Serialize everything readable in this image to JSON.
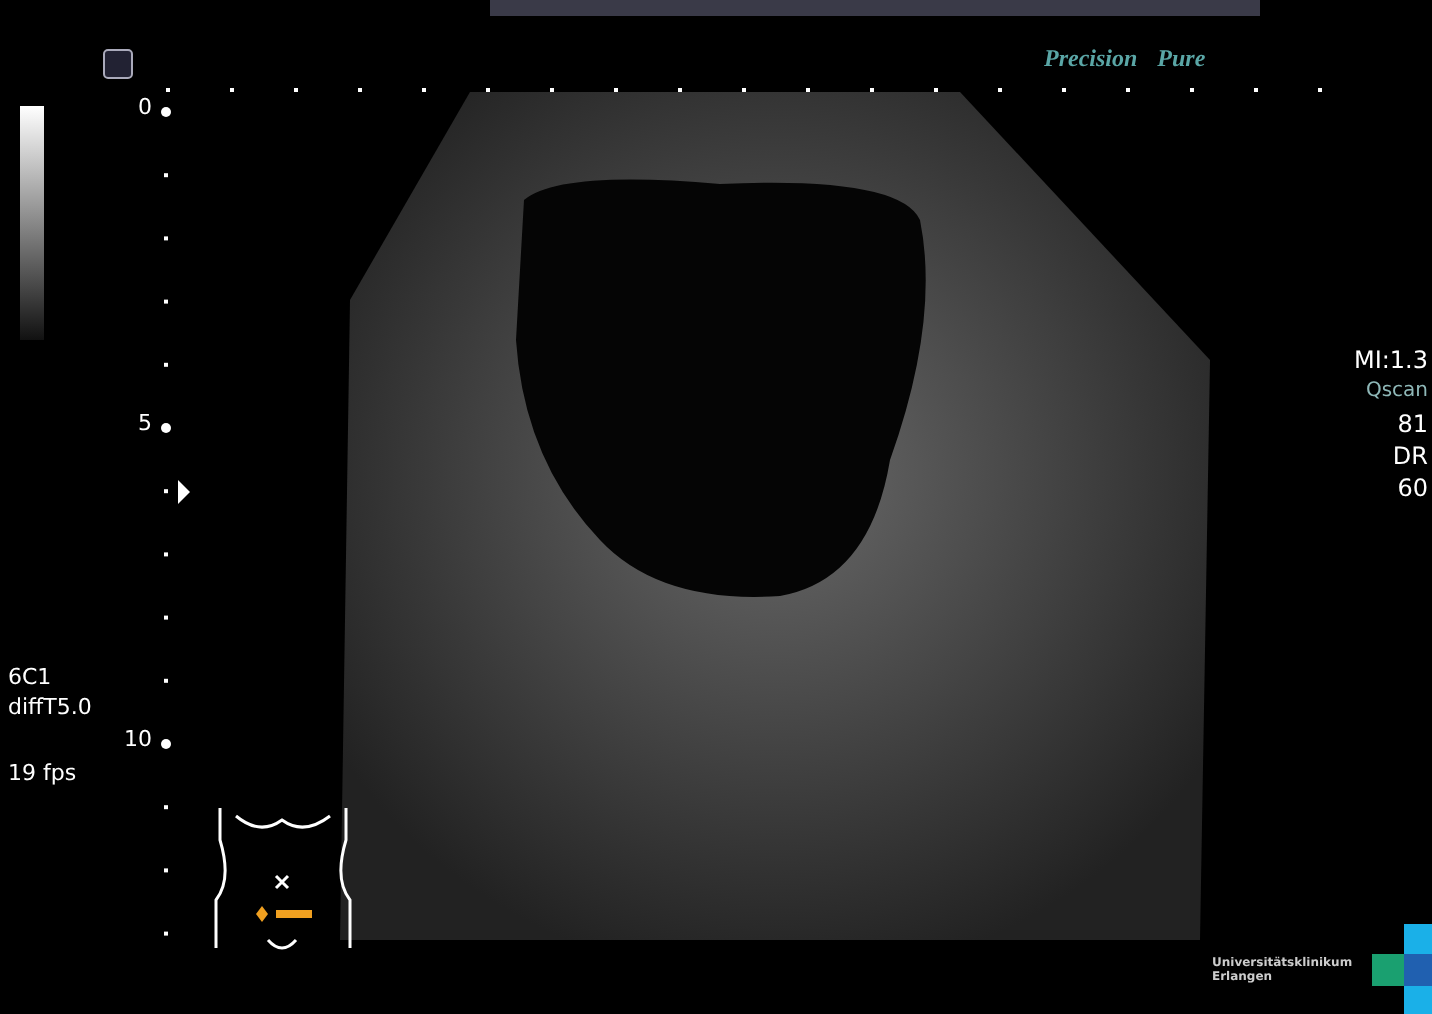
{
  "brand": {
    "word_1": "Precision",
    "word_2": "Pure"
  },
  "depth_scale": {
    "labels": [
      "0",
      "5",
      "10"
    ]
  },
  "probe_info": {
    "lines": [
      "6C1",
      "diffT5.0"
    ],
    "frame_rate": "19 fps"
  },
  "readouts": [
    {
      "kind": "value",
      "text": "MI:1.3"
    },
    {
      "kind": "label",
      "text": "Qscan"
    },
    {
      "kind": "value",
      "text": "81"
    },
    {
      "kind": "value",
      "text": "DR"
    },
    {
      "kind": "value",
      "text": "60"
    }
  ],
  "institution": {
    "lines": [
      "Universitätsklinikum",
      "Erlangen"
    ]
  }
}
